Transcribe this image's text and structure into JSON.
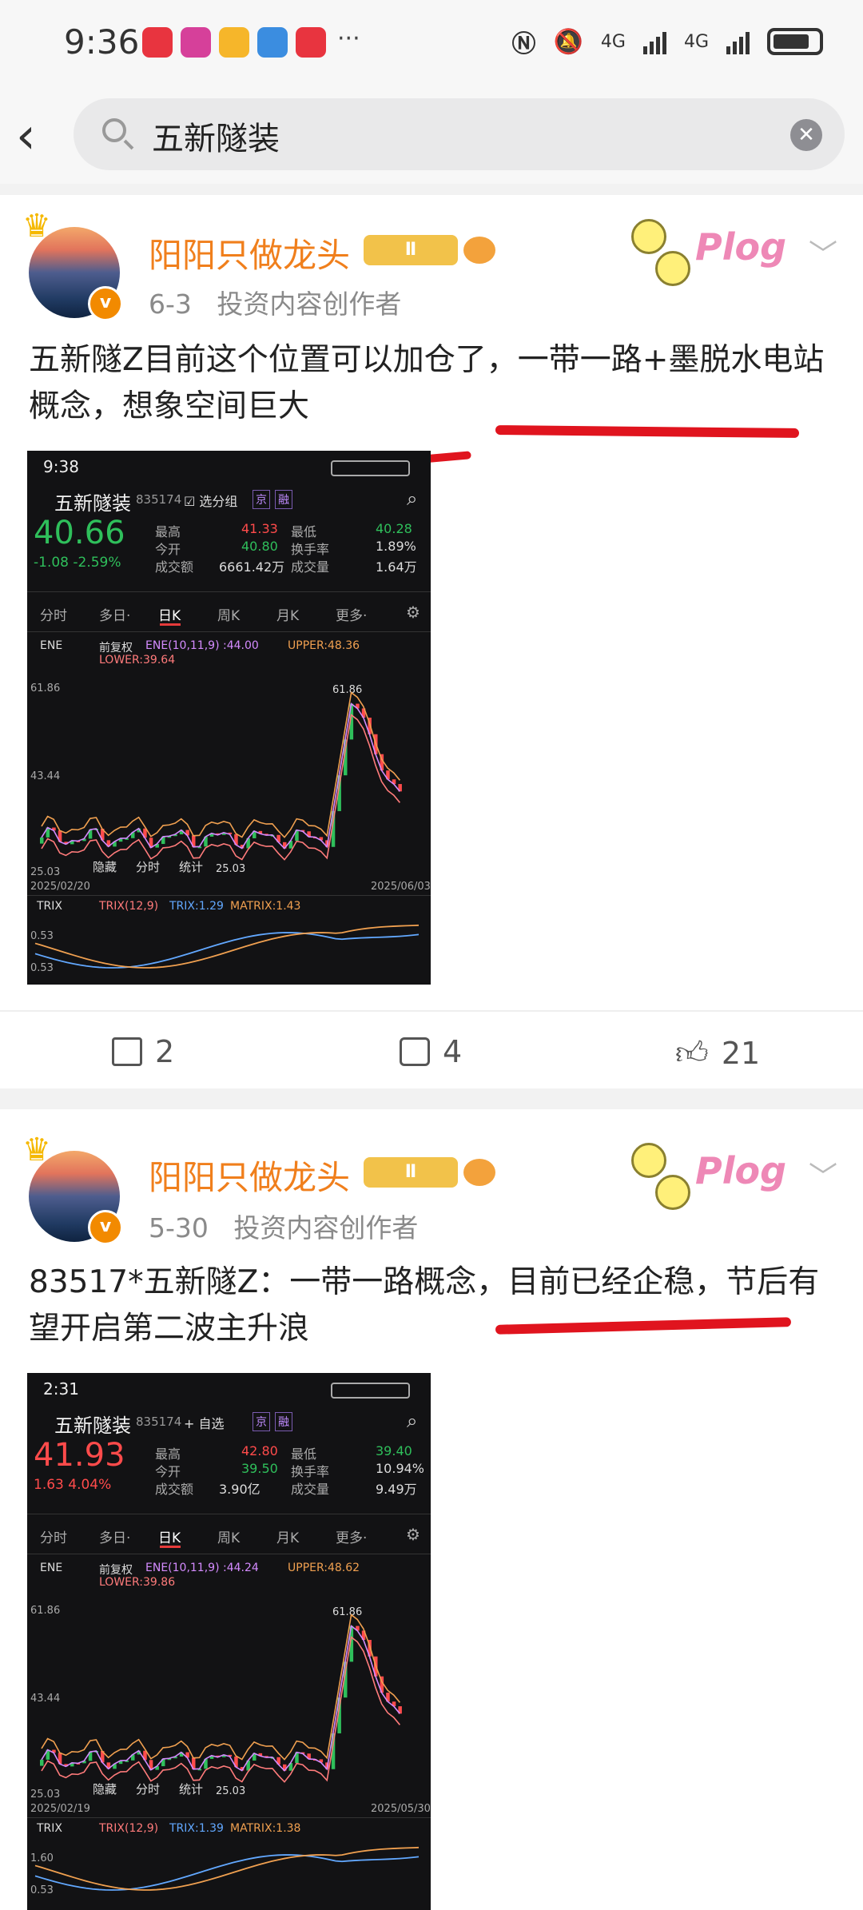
{
  "status": {
    "time": "9:36",
    "net1": "4G",
    "net2": "4G",
    "more": "···"
  },
  "search": {
    "query": "五新隧装"
  },
  "posts": [
    {
      "author": "阳阳只做龙头",
      "level": "Ⅱ",
      "date": "6-3",
      "role": "投资内容创作者",
      "sticker": "Plog",
      "text": "五新隧Z目前这个位置可以加仓了，一带一路+墨脱水电站概念，想象空间巨大",
      "shares": "2",
      "comments": "4",
      "likes": "21",
      "screenshot": {
        "time": "9:38",
        "stock": "五新隧装",
        "code": "835174",
        "add_label": "☑ 选分组",
        "tags": [
          "京",
          "融"
        ],
        "price": "40.66",
        "change": "-1.08  -2.59%",
        "high_label": "最高",
        "high": "41.33",
        "low_label": "最低",
        "low": "40.28",
        "open_label": "今开",
        "open": "40.80",
        "turnover_label": "换手率",
        "turnover": "1.89%",
        "amount_label": "成交额",
        "amount": "6661.42万",
        "volume_label": "成交量",
        "volume": "1.64万",
        "tabs": [
          "分时",
          "多日·",
          "日K",
          "周K",
          "月K",
          "更多·"
        ],
        "ene_label": "ENE",
        "adj": "前复权",
        "ene_params": "ENE(10,11,9) :44.00",
        "upper": "UPPER:48.36",
        "lower": "LOWER:39.64",
        "y_top": "61.86",
        "y_mid": "43.44",
        "y_bot": "25.03",
        "peak": "61.86",
        "trough": "25.03",
        "date_start": "2025/02/20",
        "date_end": "2025/06/03",
        "hide": "隐藏",
        "fenshi": "分时",
        "tongji": "统计",
        "trix_label": "TRIX",
        "trix": "TRIX(12,9)",
        "trix_val": "TRIX:1.29",
        "matrix": "MATRIX:1.43",
        "trix_y1": "0.53",
        "trix_y2": "0.53"
      }
    },
    {
      "author": "阳阳只做龙头",
      "level": "Ⅱ",
      "date": "5-30",
      "role": "投资内容创作者",
      "sticker": "Plog",
      "text": "83517*五新隧Z：一带一路概念，目前已经企稳，节后有望开启第二波主升浪",
      "screenshot": {
        "time": "2:31",
        "stock": "五新隧装",
        "code": "835174",
        "add_label": "+ 自选",
        "tags": [
          "京",
          "融"
        ],
        "price": "41.93",
        "change": "1.63  4.04%",
        "high_label": "最高",
        "high": "42.80",
        "low_label": "最低",
        "low": "39.40",
        "open_label": "今开",
        "open": "39.50",
        "turnover_label": "换手率",
        "turnover": "10.94%",
        "amount_label": "成交额",
        "amount": "3.90亿",
        "volume_label": "成交量",
        "volume": "9.49万",
        "tabs": [
          "分时",
          "多日·",
          "日K",
          "周K",
          "月K",
          "更多·"
        ],
        "ene_label": "ENE",
        "adj": "前复权",
        "ene_params": "ENE(10,11,9) :44.24",
        "upper": "UPPER:48.62",
        "lower": "LOWER:39.86",
        "y_top": "61.86",
        "y_mid": "43.44",
        "y_bot": "25.03",
        "peak": "61.86",
        "trough": "25.03",
        "date_start": "2025/02/19",
        "date_end": "2025/05/30",
        "hide": "隐藏",
        "fenshi": "分时",
        "tongji": "统计",
        "trix_label": "TRIX",
        "trix": "TRIX(12,9)",
        "trix_val": "TRIX:1.39",
        "matrix": "MATRIX:1.38",
        "trix_y1": "1.60",
        "trix_y2": "0.53"
      }
    }
  ],
  "colors": {
    "name": "#f07f1c",
    "red": "#e0141e",
    "up": "#ff4b4b",
    "down": "#2fbf5b"
  }
}
